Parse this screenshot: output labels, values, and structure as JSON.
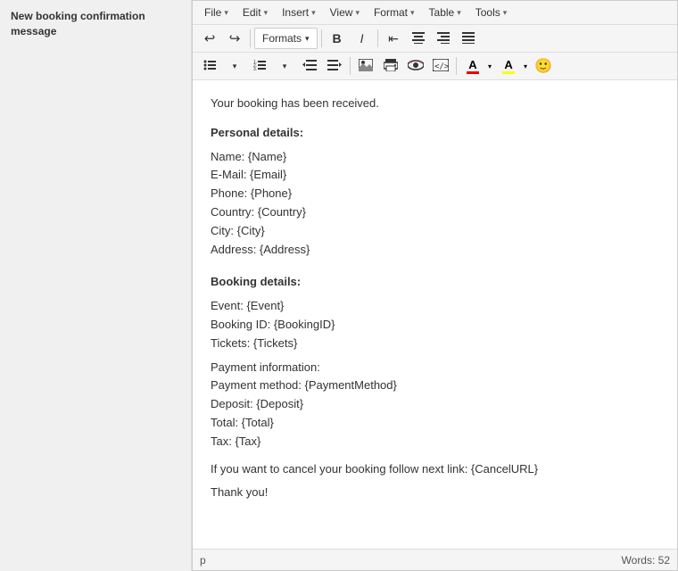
{
  "sidebar": {
    "title": "New booking confirmation message"
  },
  "menubar": {
    "items": [
      {
        "label": "File",
        "has_arrow": true
      },
      {
        "label": "Edit",
        "has_arrow": true
      },
      {
        "label": "Insert",
        "has_arrow": true
      },
      {
        "label": "View",
        "has_arrow": true
      },
      {
        "label": "Format",
        "has_arrow": true
      },
      {
        "label": "Table",
        "has_arrow": true
      },
      {
        "label": "Tools",
        "has_arrow": true
      }
    ]
  },
  "toolbar1": {
    "formats_label": "Formats",
    "bold_label": "B",
    "italic_label": "I"
  },
  "content": {
    "line1": "Your booking has been received.",
    "section1_title": "Personal details:",
    "personal": [
      "Name: {Name}",
      "E-Mail: {Email}",
      "Phone: {Phone}",
      "Country: {Country}",
      "City: {City}",
      "Address: {Address}"
    ],
    "section2_title": "Booking details:",
    "booking": [
      "Event: {Event}",
      "Booking ID: {BookingID}",
      "Tickets: {Tickets}"
    ],
    "payment_title": "Payment information:",
    "payment": [
      "Payment method: {PaymentMethod}",
      "Deposit: {Deposit}",
      "Total: {Total}",
      "Tax: {Tax}"
    ],
    "cancel_line": "If you want to cancel your booking follow next link: {CancelURL}",
    "thankyou": "Thank you!"
  },
  "statusbar": {
    "tag": "p",
    "words_label": "Words: 52"
  }
}
